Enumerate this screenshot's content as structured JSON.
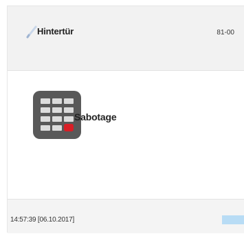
{
  "header": {
    "title": "Hintertür",
    "code": "81-00",
    "icon": "pencil-icon"
  },
  "status": {
    "icon": "keypad-icon",
    "label": "Sabotage",
    "alert_color": "#d81e26"
  },
  "footer": {
    "timestamp": "14:57:39 [06.10.2017]",
    "indicator_color": "#b8dcf5"
  }
}
